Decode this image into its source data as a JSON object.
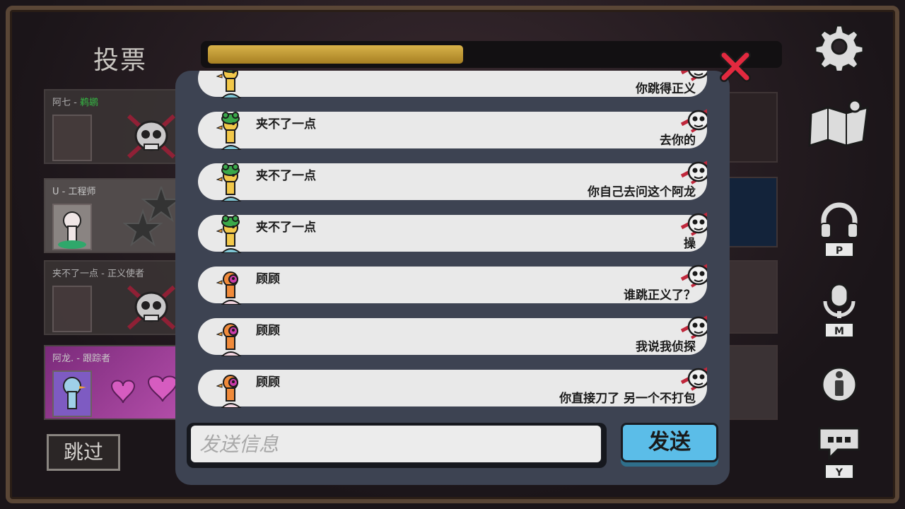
{
  "header": {
    "title": "投票",
    "vote_progress": 0.45
  },
  "players": [
    {
      "name": "阿七 - ",
      "role": "鹈鹕",
      "status": "dead"
    },
    {
      "name": "U - 工程师",
      "role": "",
      "status": "alive"
    },
    {
      "name": "夹不了一点 - 正义使者",
      "role": "",
      "status": "dead"
    },
    {
      "name": "阿龙. - 跟踪者",
      "role": "",
      "status": "alive"
    }
  ],
  "skip_label": "跳过",
  "sidebar": {
    "icons": [
      "gear-icon",
      "map-icon",
      "headphones-icon",
      "microphone-icon",
      "info-icon",
      "chat-icon"
    ],
    "keys": {
      "headphones": "P",
      "microphone": "M",
      "chat": "Y"
    }
  },
  "chat": {
    "messages": [
      {
        "sender": "",
        "text": "你跳得正义",
        "avatar": "frog-goose"
      },
      {
        "sender": "夹不了一点",
        "text": "去你的",
        "avatar": "frog-goose"
      },
      {
        "sender": "夹不了一点",
        "text": "你自己去问这个阿龙",
        "avatar": "frog-goose"
      },
      {
        "sender": "夹不了一点",
        "text": "操",
        "avatar": "frog-goose"
      },
      {
        "sender": "顾顾",
        "text": "谁跳正义了？",
        "avatar": "orange-goose"
      },
      {
        "sender": "顾顾",
        "text": "我说我侦探",
        "avatar": "orange-goose"
      },
      {
        "sender": "顾顾",
        "text": "你直接刀了  另一个不打包",
        "avatar": "orange-goose"
      }
    ],
    "input_placeholder": "发送信息",
    "send_label": "发送"
  },
  "colors": {
    "accent_blue": "#5bbde8",
    "progress_gold": "#c9a23a",
    "close_red": "#e2293f"
  }
}
